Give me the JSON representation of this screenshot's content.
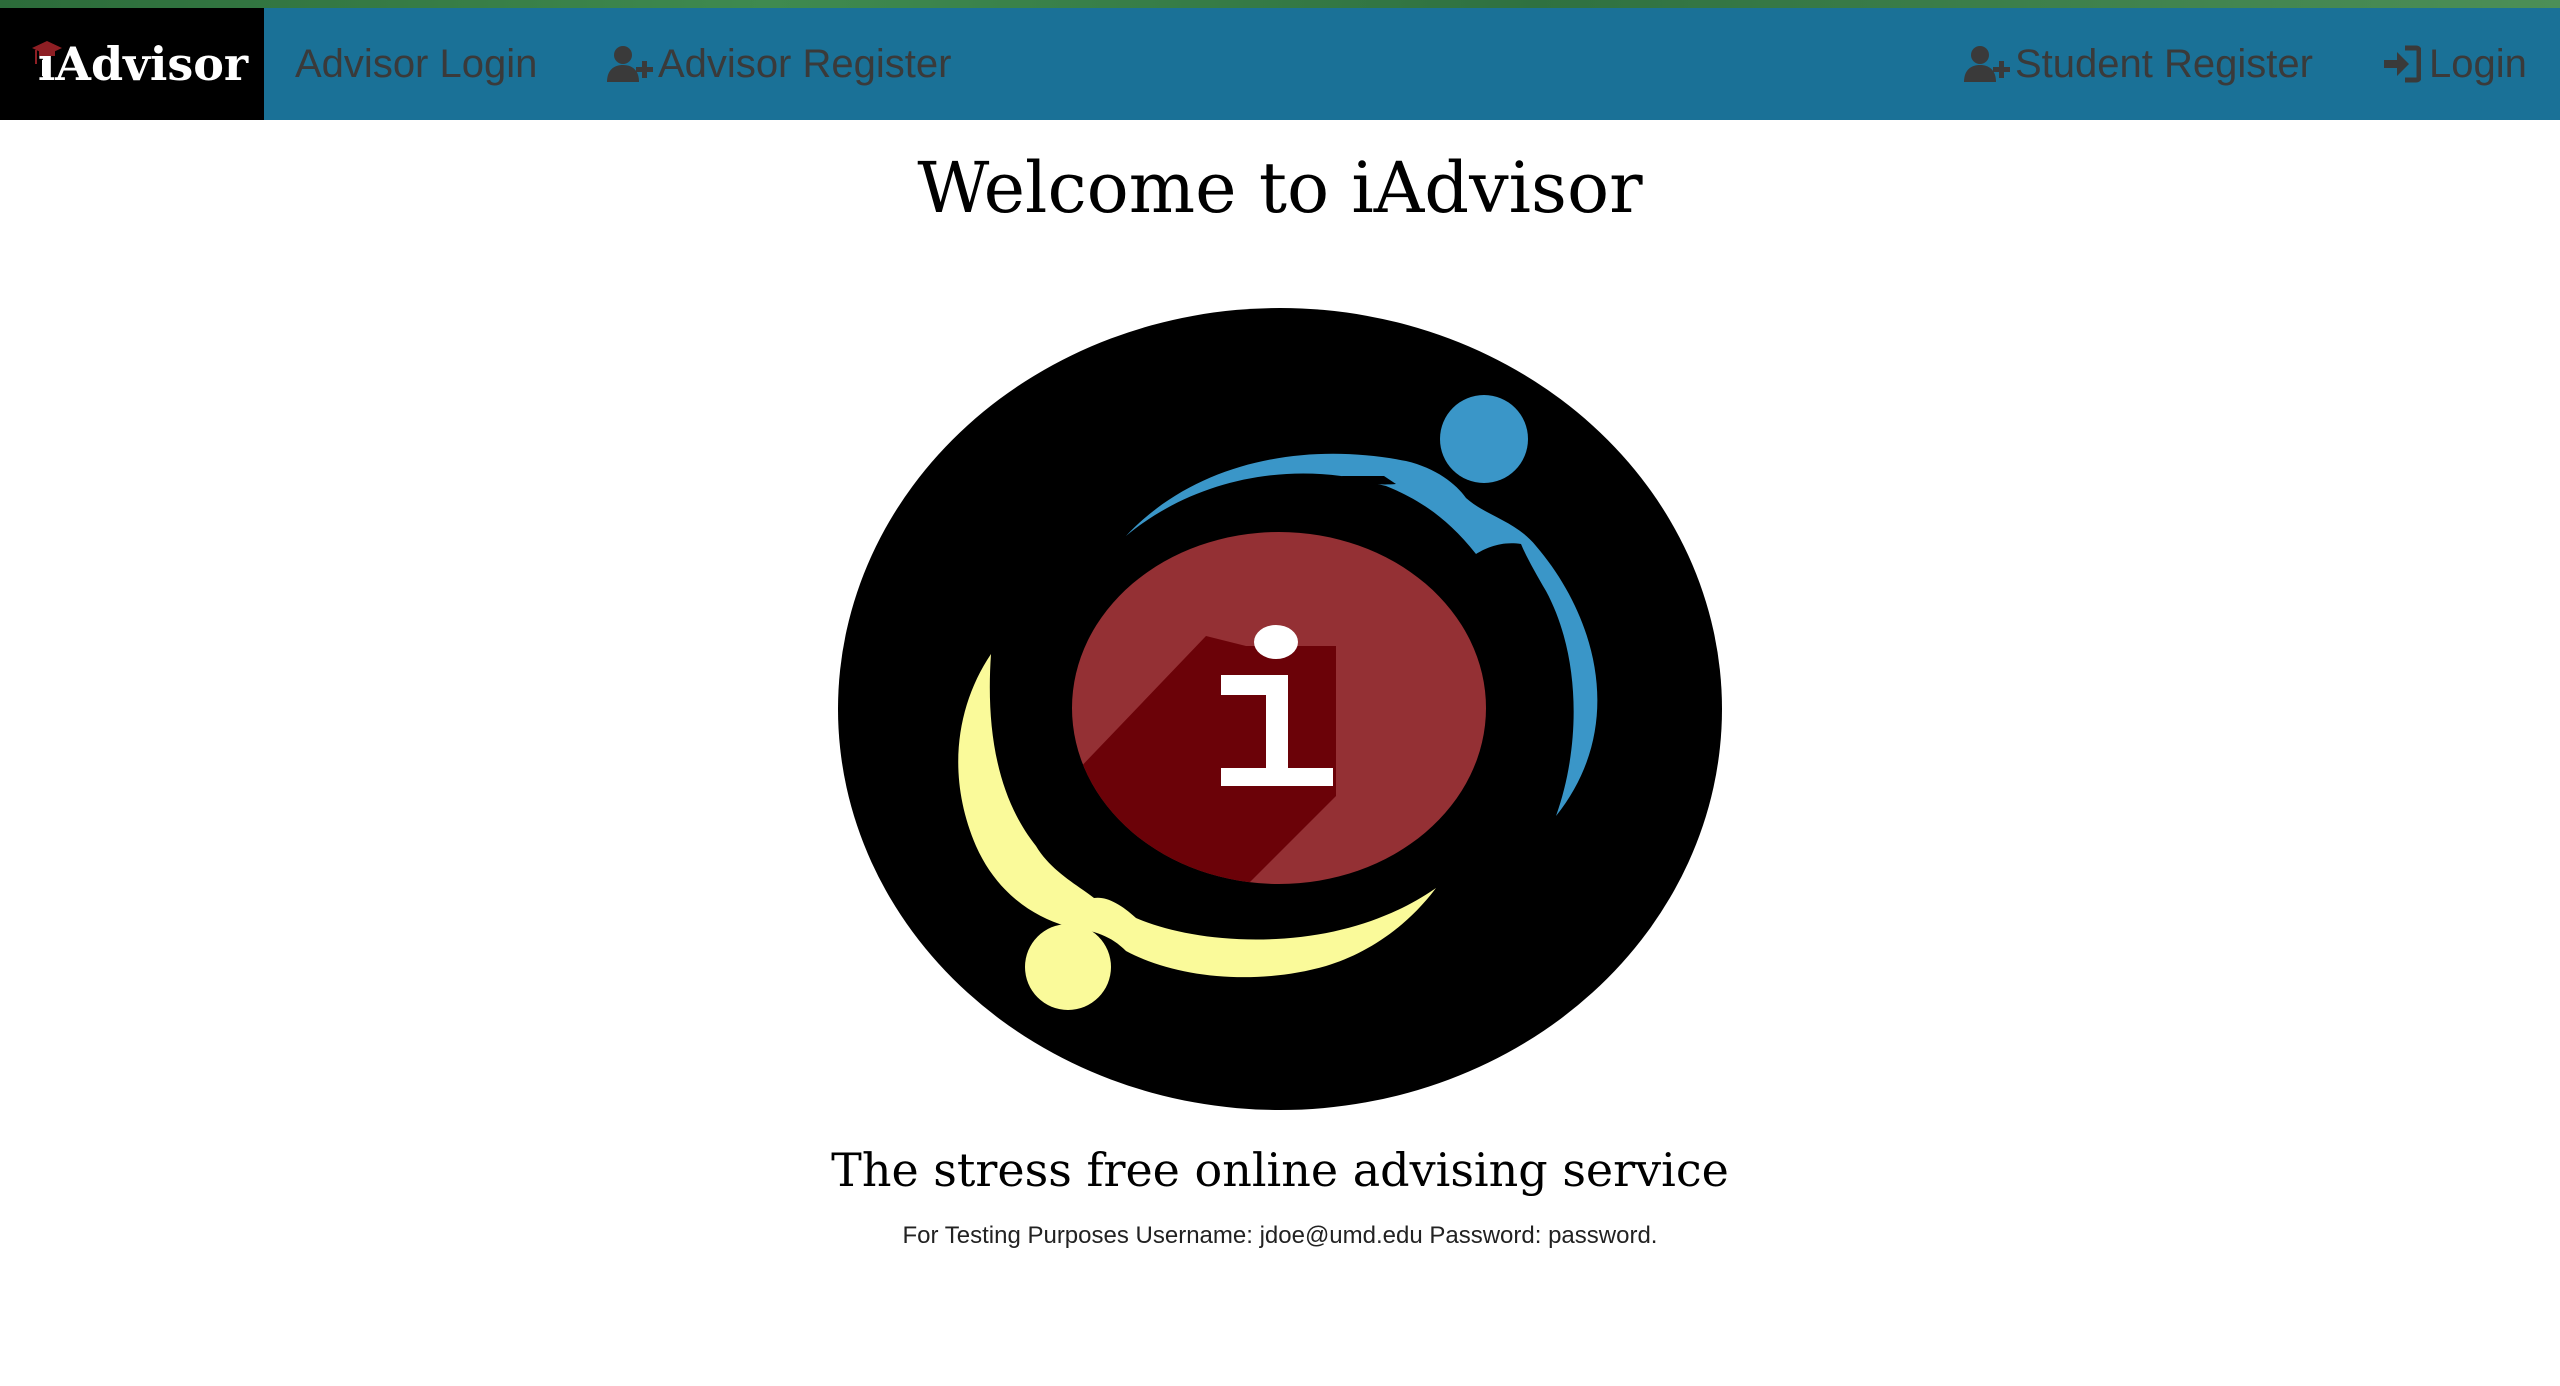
{
  "navbar": {
    "brand": "iAdvisor",
    "advisor_login": "Advisor Login",
    "advisor_register": "Advisor Register",
    "student_register": "Student Register",
    "login": "Login"
  },
  "main": {
    "title": "Welcome to iAdvisor",
    "tagline": "The stress free online advising service",
    "testing_note": "For Testing Purposes Username: jdoe@umd.edu Password: password."
  },
  "colors": {
    "navbar": "#1a7197",
    "brand_bg": "#000000",
    "nav_text": "#3a3a3a",
    "logo_circle": "#000000",
    "logo_center": "#943034",
    "logo_shadow": "#6b0208",
    "logo_blue_figure": "#3a96c8",
    "logo_yellow_figure": "#fafa9a"
  },
  "icons": {
    "brand": "graduation-cap-icon",
    "advisor_register": "user-plus-icon",
    "student_register": "user-plus-icon",
    "login": "sign-in-icon"
  }
}
